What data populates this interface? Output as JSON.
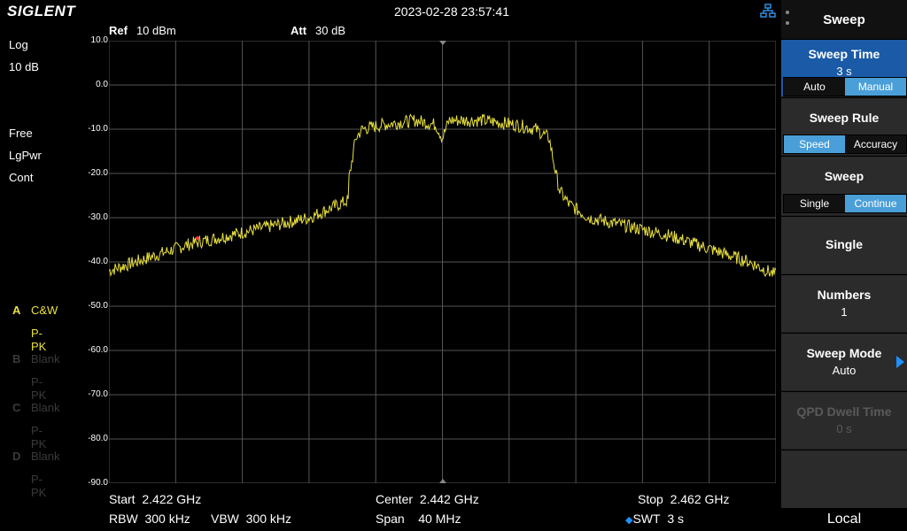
{
  "top": {
    "brand": "SIGLENT",
    "datetime": "2023-02-28 23:57:41",
    "network_icon": "network-icon"
  },
  "left_panel": {
    "scale_type": "Log",
    "scale_div": "10 dB",
    "trigger": "Free",
    "detector": "LgPwr",
    "sweep_mode": "Cont",
    "traces": [
      {
        "letter": "A",
        "mode": "C&W",
        "detector": "P-PK",
        "active": true
      },
      {
        "letter": "B",
        "mode": "Blank",
        "detector": "P-PK",
        "active": false
      },
      {
        "letter": "C",
        "mode": "Blank",
        "detector": "P-PK",
        "active": false
      },
      {
        "letter": "D",
        "mode": "Blank",
        "detector": "P-PK",
        "active": false
      }
    ]
  },
  "header": {
    "ref_label": "Ref",
    "ref_value": "10 dBm",
    "att_label": "Att",
    "att_value": "30 dB"
  },
  "bottom": {
    "start_label": "Start",
    "start_value": "2.422 GHz",
    "center_label": "Center",
    "center_value": "2.442 GHz",
    "stop_label": "Stop",
    "stop_value": "2.462 GHz",
    "rbw_label": "RBW",
    "rbw_value": "300 kHz",
    "vbw_label": "VBW",
    "vbw_value": "300 kHz",
    "span_label": "Span",
    "span_value": "40 MHz",
    "swt_label": "SWT",
    "swt_value": "3 s"
  },
  "menu": {
    "title": "Sweep",
    "sweep_time": {
      "label": "Sweep Time",
      "value": "3 s",
      "options": [
        "Auto",
        "Manual"
      ],
      "selected": "Manual"
    },
    "sweep_rule": {
      "label": "Sweep Rule",
      "options": [
        "Speed",
        "Accuracy"
      ],
      "selected": "Speed"
    },
    "sweep": {
      "label": "Sweep",
      "options": [
        "Single",
        "Continue"
      ],
      "selected": "Continue"
    },
    "single": {
      "label": "Single"
    },
    "numbers": {
      "label": "Numbers",
      "value": "1"
    },
    "sweep_mode": {
      "label": "Sweep Mode",
      "value": "Auto"
    },
    "qpd": {
      "label": "QPD Dwell Time",
      "value": "0 s"
    },
    "local": "Local"
  },
  "colors": {
    "trace": "#e8e040",
    "grid": "#555555",
    "active_menu": "#1a5aa7",
    "selected_option": "#4a9fd8"
  },
  "chart_data": {
    "type": "line",
    "title": "",
    "xlabel": "",
    "ylabel": "",
    "x_unit": "GHz",
    "y_unit": "dBm",
    "xlim": [
      2.422,
      2.462
    ],
    "ylim": [
      -90,
      10
    ],
    "y_ticks": [
      "10.0",
      "0.0",
      "-10.0",
      "-20.0",
      "-30.0",
      "-40.0",
      "-50.0",
      "-60.0",
      "-70.0",
      "-80.0",
      "-90.0"
    ],
    "grid": true,
    "series": [
      {
        "name": "A",
        "x": [
          2.422,
          2.4244,
          2.4268,
          2.4292,
          2.4316,
          2.434,
          2.4364,
          2.43636,
          2.4368,
          2.4372,
          2.4384,
          2.4404,
          2.4416,
          2.442,
          2.4424,
          2.4444,
          2.4464,
          2.4476,
          2.4484,
          2.4488,
          2.44904,
          2.4496,
          2.4508,
          2.4532,
          2.4556,
          2.458,
          2.4604,
          2.462
        ],
        "y": [
          -42,
          -39,
          -36,
          -34,
          -32,
          -30,
          -26,
          -22,
          -12,
          -10,
          -9,
          -8,
          -9,
          -12,
          -8,
          -8,
          -9,
          -10,
          -12,
          -20,
          -24,
          -27,
          -30,
          -32,
          -34,
          -37,
          -40,
          -43
        ]
      }
    ]
  }
}
